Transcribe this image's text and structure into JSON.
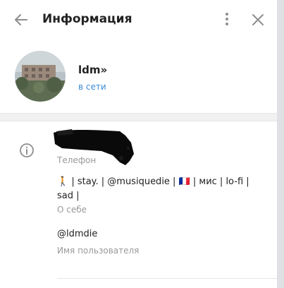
{
  "header": {
    "title": "Информация"
  },
  "profile": {
    "name": "ldm»",
    "status": "в сети"
  },
  "info": {
    "phone_label": "Телефон",
    "about_text": "🚶 | stay. | @musiquedie | 🇫🇷 | мис | lo-fi | sad |",
    "about_label": "О себе",
    "username_value": "@ldmdie",
    "username_label": "Имя пользователя"
  },
  "colors": {
    "accent": "#3a8bd5",
    "label": "#999999",
    "icon": "#8e8e8e"
  }
}
